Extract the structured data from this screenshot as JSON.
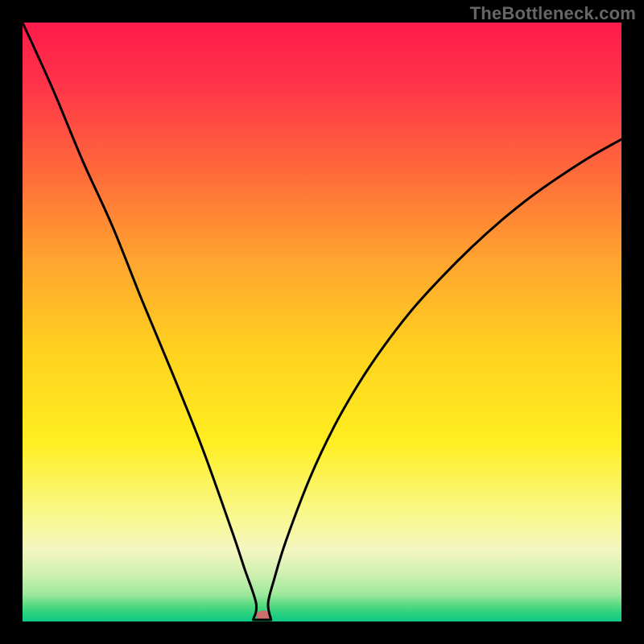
{
  "watermark": "TheBottleneck.com",
  "chart_data": {
    "type": "line",
    "title": "",
    "xlabel": "",
    "ylabel": "",
    "xlim": [
      0,
      100
    ],
    "ylim": [
      0,
      100
    ],
    "notch": {
      "x": 40,
      "bottom_width": 3
    },
    "series": [
      {
        "name": "curve",
        "x": [
          0,
          5,
          10,
          15,
          20,
          25,
          30,
          35,
          37,
          39,
          40,
          41,
          42,
          44,
          48,
          52,
          56,
          60,
          65,
          70,
          75,
          80,
          85,
          90,
          95,
          100
        ],
        "values": [
          100,
          89,
          77,
          66,
          53.5,
          41.5,
          29,
          15,
          9,
          3,
          0,
          3,
          7,
          13.5,
          24,
          32.5,
          39.5,
          45.5,
          52,
          57.5,
          62.5,
          67,
          71,
          74.5,
          77.7,
          80.5
        ]
      }
    ],
    "gradient_stops": [
      {
        "offset": 0.0,
        "color": "#ff1a4a"
      },
      {
        "offset": 0.1,
        "color": "#ff334a"
      },
      {
        "offset": 0.25,
        "color": "#ff6a3a"
      },
      {
        "offset": 0.4,
        "color": "#ffa52f"
      },
      {
        "offset": 0.55,
        "color": "#ffd21e"
      },
      {
        "offset": 0.7,
        "color": "#ffee20"
      },
      {
        "offset": 0.82,
        "color": "#f8f88a"
      },
      {
        "offset": 0.88,
        "color": "#f4f6c0"
      },
      {
        "offset": 0.92,
        "color": "#d0f0b0"
      },
      {
        "offset": 0.955,
        "color": "#9de89c"
      },
      {
        "offset": 0.975,
        "color": "#4fd87f"
      },
      {
        "offset": 0.99,
        "color": "#1fcf80"
      },
      {
        "offset": 1.0,
        "color": "#12c884"
      }
    ],
    "marker": {
      "x": 40.2,
      "y": 1.0,
      "color": "#cc6f6a",
      "rx": 9,
      "ry": 6
    }
  }
}
